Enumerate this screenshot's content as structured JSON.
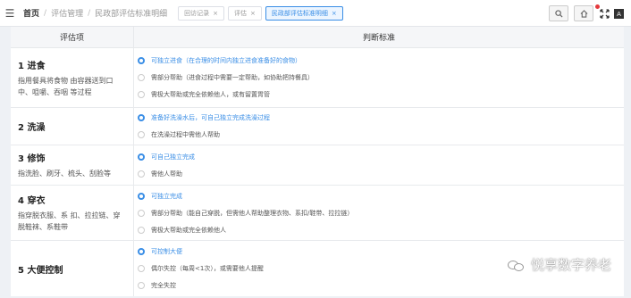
{
  "breadcrumb": {
    "home": "首页",
    "section": "评估管理",
    "current": "民政部评估标准明细"
  },
  "tabs": [
    {
      "label": "回访记录",
      "active": false
    },
    {
      "label": "评估",
      "active": false
    },
    {
      "label": "民政部评估标准明细",
      "active": true
    }
  ],
  "table": {
    "col_item": "评估项",
    "col_criteria": "判断标准",
    "rows": [
      {
        "title": "1 进食",
        "desc": "指用餐具将食物 由容器送到口中、咀嚼、吞咽 等过程",
        "options": [
          {
            "text": "可独立进食（在合理的时间内独立进食准备好的食物）",
            "checked": true
          },
          {
            "text": "需部分帮助（进食过程中需要一定帮助，如协助把持餐具）",
            "checked": false
          },
          {
            "text": "需极大帮助或完全依赖他人，或有留置胃管",
            "checked": false
          }
        ]
      },
      {
        "title": "2 洗澡",
        "desc": "",
        "options": [
          {
            "text": "准备好洗澡水后，可自己独立完成洗澡过程",
            "checked": true
          },
          {
            "text": "在洗澡过程中需他人帮助",
            "checked": false
          }
        ]
      },
      {
        "title": "3 修饰",
        "desc": "指洗脸、刷牙、梳头、刮脸等",
        "options": [
          {
            "text": "可自己独立完成",
            "checked": true
          },
          {
            "text": "需他人帮助",
            "checked": false
          }
        ]
      },
      {
        "title": "4 穿衣",
        "desc": "指穿脱衣服、系 扣、拉拉链、穿脱鞋袜、系鞋带",
        "options": [
          {
            "text": "可独立完成",
            "checked": true
          },
          {
            "text": "需部分帮助（能自己穿脱，但需他人帮助整理衣物、系扣/鞋带、拉拉链）",
            "checked": false
          },
          {
            "text": "需极大帮助或完全依赖他人",
            "checked": false
          }
        ]
      },
      {
        "title": "5 大便控制",
        "desc": "",
        "options": [
          {
            "text": "可控制大便",
            "checked": true
          },
          {
            "text": "偶尔失控（每周<1次），或需要他人提醒",
            "checked": false
          },
          {
            "text": "完全失控",
            "checked": false
          }
        ]
      }
    ]
  },
  "watermark": "悦享数字养老",
  "colors": {
    "accent": "#3a8ee6",
    "header_bg": "#f5f6f8",
    "page_bg": "#eef1f5"
  },
  "icons": [
    "menu-icon",
    "search-icon",
    "home-icon",
    "red-dot",
    "fullscreen-icon",
    "language-icon",
    "wechat-icon"
  ]
}
